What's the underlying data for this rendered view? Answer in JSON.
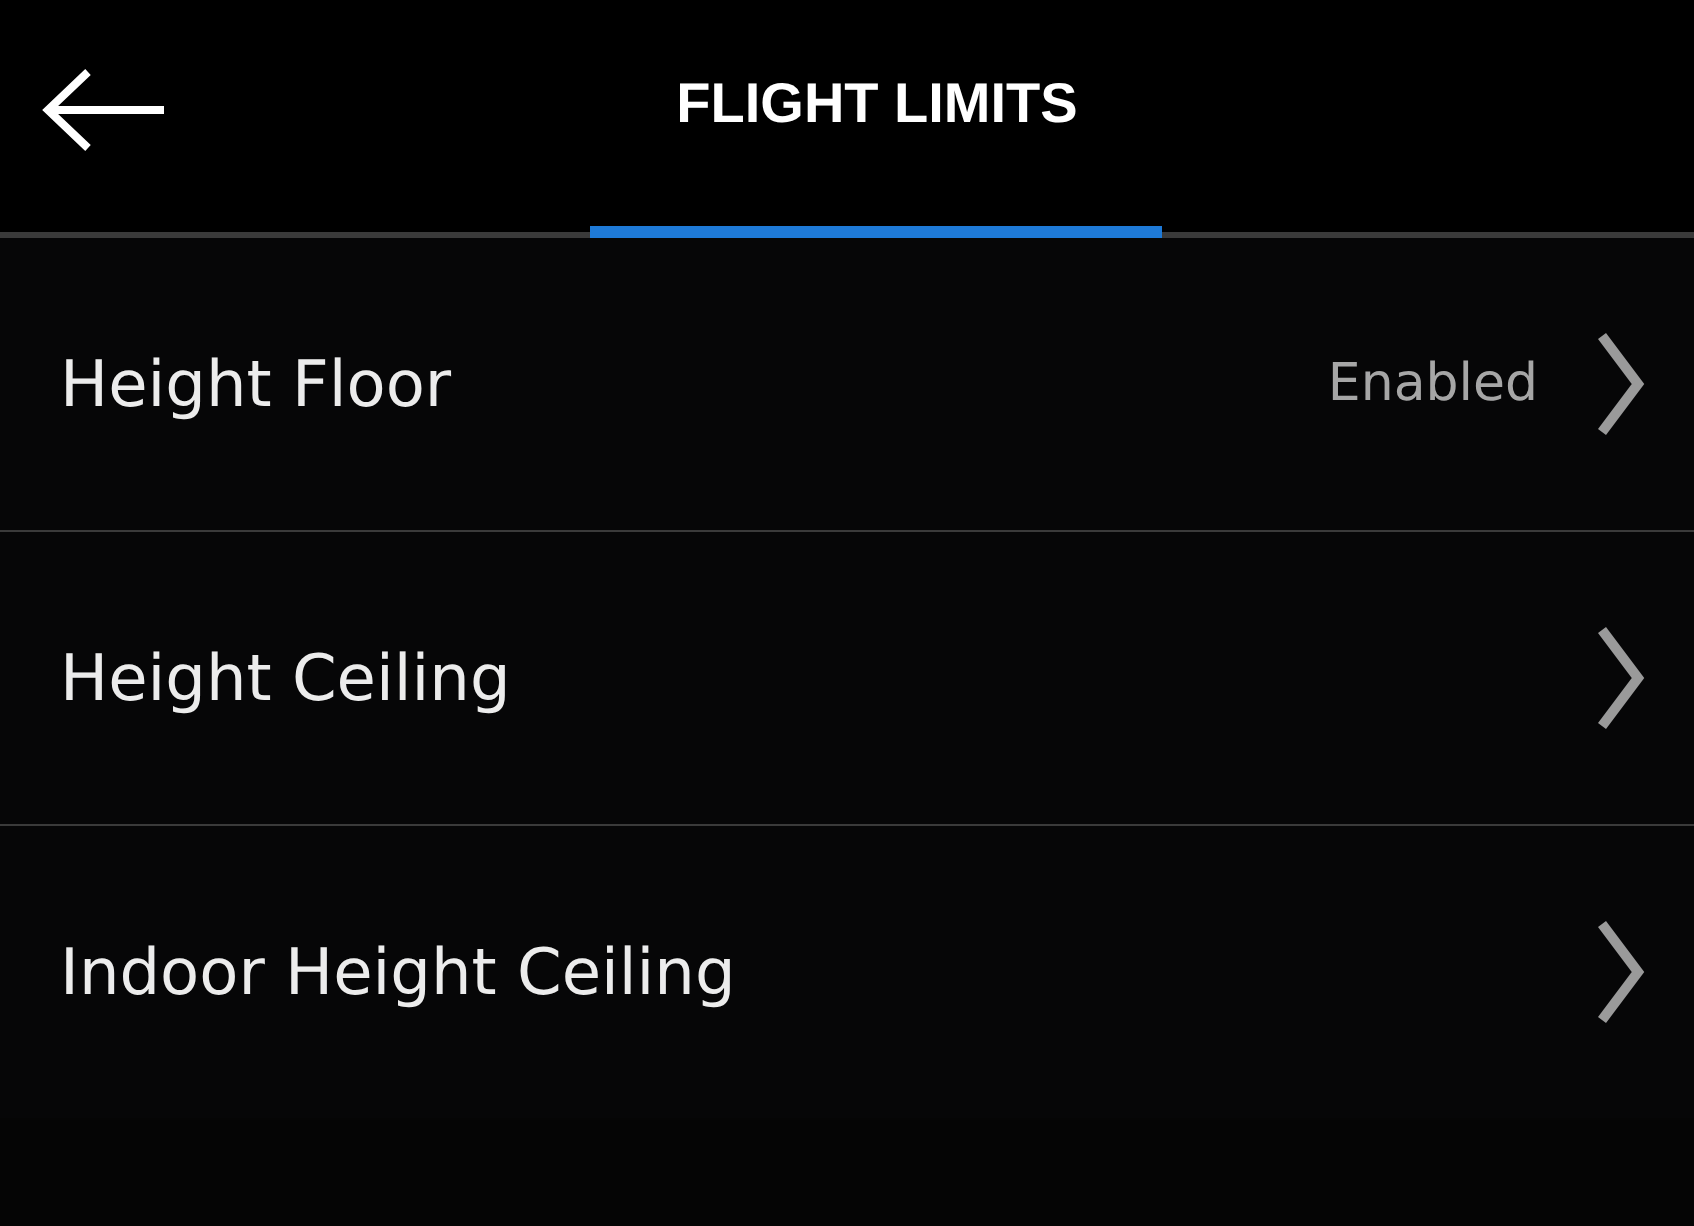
{
  "header": {
    "title": "FLIGHT LIMITS"
  },
  "items": [
    {
      "label": "Height Floor",
      "value": "Enabled"
    },
    {
      "label": "Height Ceiling"
    },
    {
      "label": "Indoor Height Ceiling"
    }
  ]
}
